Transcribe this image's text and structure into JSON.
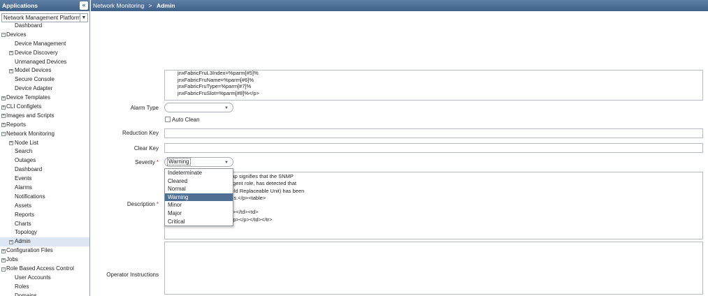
{
  "sidebar": {
    "header": "Applications",
    "collapse_icon": "«",
    "platform_select": "Network Management Platform",
    "tree": [
      {
        "label": "Dashboard",
        "level": 1,
        "toggle": ""
      },
      {
        "label": "Devices",
        "level": 0,
        "toggle": "−"
      },
      {
        "label": "Device Management",
        "level": 1,
        "toggle": ""
      },
      {
        "label": "Device Discovery",
        "level": 1,
        "toggle": "+"
      },
      {
        "label": "Unmanaged Devices",
        "level": 1,
        "toggle": ""
      },
      {
        "label": "Model Devices",
        "level": 1,
        "toggle": "+"
      },
      {
        "label": "Secure Console",
        "level": 1,
        "toggle": ""
      },
      {
        "label": "Device Adapter",
        "level": 1,
        "toggle": ""
      },
      {
        "label": "Device Templates",
        "level": 0,
        "toggle": "+"
      },
      {
        "label": "CLI Configlets",
        "level": 0,
        "toggle": "+"
      },
      {
        "label": "Images and Scripts",
        "level": 0,
        "toggle": "+"
      },
      {
        "label": "Reports",
        "level": 0,
        "toggle": "+"
      },
      {
        "label": "Network Monitoring",
        "level": 0,
        "toggle": "−"
      },
      {
        "label": "Node List",
        "level": 1,
        "toggle": "+"
      },
      {
        "label": "Search",
        "level": 1,
        "toggle": ""
      },
      {
        "label": "Outages",
        "level": 1,
        "toggle": ""
      },
      {
        "label": "Dashboard",
        "level": 1,
        "toggle": ""
      },
      {
        "label": "Events",
        "level": 1,
        "toggle": ""
      },
      {
        "label": "Alarms",
        "level": 1,
        "toggle": ""
      },
      {
        "label": "Notifications",
        "level": 1,
        "toggle": ""
      },
      {
        "label": "Assets",
        "level": 1,
        "toggle": ""
      },
      {
        "label": "Reports",
        "level": 1,
        "toggle": ""
      },
      {
        "label": "Charts",
        "level": 1,
        "toggle": ""
      },
      {
        "label": "Topology",
        "level": 1,
        "toggle": ""
      },
      {
        "label": "Admin",
        "level": 1,
        "toggle": "+",
        "selected": true
      },
      {
        "label": "Configuration Files",
        "level": 0,
        "toggle": "+"
      },
      {
        "label": "Jobs",
        "level": 0,
        "toggle": "+"
      },
      {
        "label": "Role Based Access Control",
        "level": 0,
        "toggle": "−"
      },
      {
        "label": "User Accounts",
        "level": 1,
        "toggle": ""
      },
      {
        "label": "Roles",
        "level": 1,
        "toggle": ""
      },
      {
        "label": "Domains",
        "level": 1,
        "toggle": ""
      }
    ]
  },
  "breadcrumb": {
    "parent": "Network Monitoring",
    "separator": ">",
    "current": "Admin"
  },
  "form": {
    "snippet_lines": [
      "jnxFabricFruL3Index=%parm[#5]%",
      "jnxFabricFruName=%parm[#6]%",
      "jnxFabricFruType=%parm[#7]%",
      "jnxFabricFruSlot=%parm[#8]%</p>"
    ],
    "alarm_type_label": "Alarm Type",
    "alarm_type_value": "",
    "auto_clean_label": "Auto Clean",
    "auto_clean_checked": false,
    "reduction_key_label": "Reduction Key",
    "reduction_key_value": "",
    "clear_key_label": "Clear Key",
    "clear_key_value": "",
    "severity_label": "Severity",
    "severity_value": "Warning",
    "severity_options": [
      "Indeterminate",
      "Cleared",
      "Normal",
      "Warning",
      "Minor",
      "Major",
      "Critical"
    ],
    "severity_highlighted": "Warning",
    "description_label": "Description",
    "description_lines": [
      "rap signifies that the SNMP",
      "agent role, has detected that",
      "ield Replaceable Unit) has been",
      "sis.</p><table>",
      "",
      "b></td><td>",
      "<p></p></td></tr>"
    ],
    "operator_instructions_label": "Operator Instructions",
    "required_mark": "*"
  },
  "colors": {
    "header_bar": "#4a6c93",
    "highlight": "#4f6f93",
    "required": "#c0392b",
    "selected_tree": "#dde7f3"
  }
}
